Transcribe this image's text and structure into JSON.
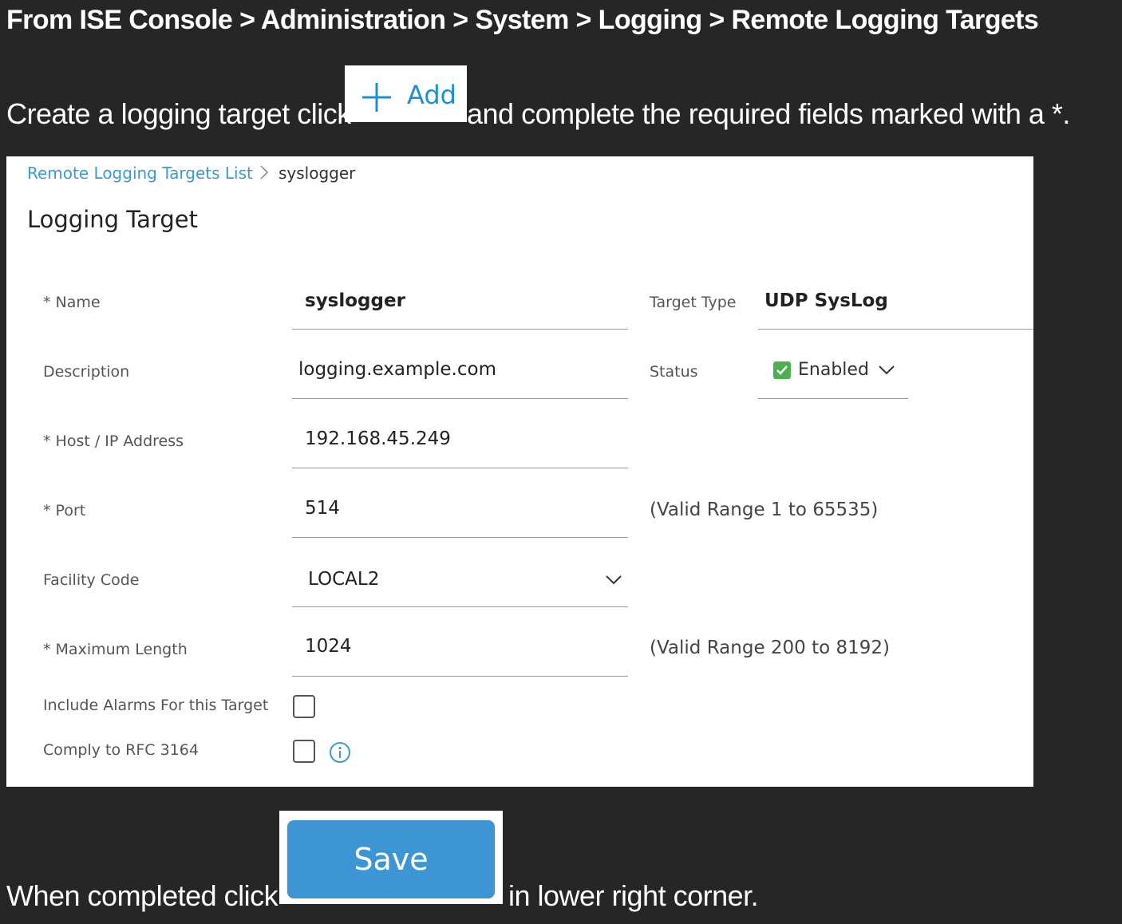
{
  "heading": "From ISE Console > Administration > System > Logging > Remote Logging Targets",
  "step1": {
    "before": "Create a logging target click",
    "add_label": "Add",
    "after": "and complete the required fields marked with a *."
  },
  "panel": {
    "breadcrumb_link": "Remote Logging Targets List",
    "breadcrumb_current": "syslogger",
    "title": "Logging Target",
    "fields": {
      "name_label": "* Name",
      "name_value": "syslogger",
      "description_label": "Description",
      "description_value": "logging.example.com",
      "host_label": "* Host / IP Address",
      "host_value": "192.168.45.249",
      "port_label": "* Port",
      "port_value": "514",
      "port_hint": "(Valid Range 1 to 65535)",
      "facility_label": "Facility Code",
      "facility_value": "LOCAL2",
      "maxlen_label": "* Maximum Length",
      "maxlen_value": "1024",
      "maxlen_hint": "(Valid Range 200 to 8192)",
      "alarms_label": "Include Alarms For this Target",
      "rfc_label": "Comply to RFC 3164",
      "target_type_label": "Target Type",
      "target_type_value": "UDP SysLog",
      "status_label": "Status",
      "status_value": "Enabled"
    },
    "colors": {
      "accent": "#3a9bd5",
      "status_check": "#4caf50"
    }
  },
  "step2": {
    "before": "When completed click",
    "save_label": "Save",
    "after": "in lower right corner."
  }
}
